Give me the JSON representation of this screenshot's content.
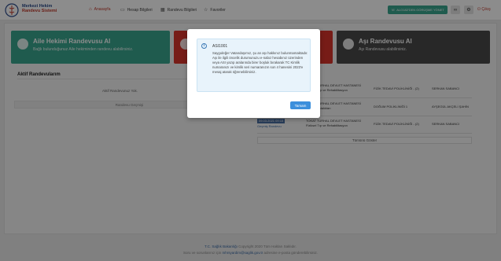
{
  "header": {
    "logo": {
      "line1": "Merkezi Hekim",
      "line2": "Randevu Sistemi",
      "line3": ""
    },
    "nav": [
      {
        "label": "Anasayfa",
        "icon": "home-icon",
        "active": true
      },
      {
        "label": "Hesap Bilgileri",
        "icon": "id-card-icon",
        "active": false
      },
      {
        "label": "Randevu Bilgileri",
        "icon": "calendar-icon",
        "active": false
      },
      {
        "label": "Favoriler",
        "icon": "star-icon",
        "active": false
      }
    ],
    "green_button": "ALO182'DEN GÖRÜŞME YÖNET",
    "logout": "Çıkış"
  },
  "cards": [
    {
      "title": "Aile Hekimi Randevusu Al",
      "subtitle": "Bağlı bulunduğunuz Aile hekiminden randevu alabilirsiniz.",
      "color": "#3aa68f"
    },
    {
      "title": "",
      "subtitle": "",
      "color": "#d9342b"
    },
    {
      "title": "Aşı Randevusu Al",
      "subtitle": "Aşı Randevusu alabilirsiniz.",
      "color": "#4a4a4a"
    }
  ],
  "active_appointments": {
    "title": "Aktif Randevularım",
    "empty_text": "Aktif Randevunuz Yok.",
    "empty_button": "Randevu Geçmişi"
  },
  "past_appointments": [
    {
      "date": "",
      "status": "",
      "hospital": "TOKAT TURHAL DEVLET HASTANESİ",
      "clinic_type": "Fiziksel Tıp ve Rehabilitasyon",
      "clinic": "FİZİK TEDAVİ POLİKLİNİĞİ - (2)",
      "doctor": "SERKAN SABANCI"
    },
    {
      "date": "",
      "status": "",
      "hospital": "TOKAT TURHAL DEVLET HASTANESİ",
      "clinic_type": "Kadın Hastalıkları",
      "clinic": "DOĞUM POLİKLİNİĞİ 1",
      "doctor": "AYŞEGÜL AKÇELİ ŞAHİN"
    },
    {
      "date": "09.03.2021 09:15",
      "status": "Geçmiş Randevu",
      "hospital": "TOKAT TURHAL DEVLET HASTANESİ",
      "clinic_type": "Fiziksel Tıp ve Rehabilitasyon",
      "clinic": "FİZİK TEDAVİ POLİKLİNİĞİ - (2)",
      "doctor": "SERKAN SABANCI"
    }
  ],
  "all_button": "Tümünü Göster",
  "footer": {
    "brand": "T.C. Sağlık Bakanlığı",
    "copyright": "Copyright 2020 Tüm Hakları Saklıdır.",
    "line2_pre": "Soru ve sorunlarınız için",
    "email": "mhrsyardim@saglik.gov.tr",
    "line2_post": "adresine e-posta gönderebilirsiniz."
  },
  "modal": {
    "title": "ASI1001",
    "body": "Saygıdeğer Vatandaşımız, şu an aşı hakkınız bulunmamaktadır. Aşı ile ilgili öncelik durumunuzu e-nabız hesabınız üzerinden veya ASI yazıp aralarında birer boşluk bırakarak TC Kimlik numaranızı ve kimlik seri numaranızın son 4 hanesini 2023'e mesaj atarak öğrenebilirsiniz.",
    "ok_button": "Tamam"
  }
}
